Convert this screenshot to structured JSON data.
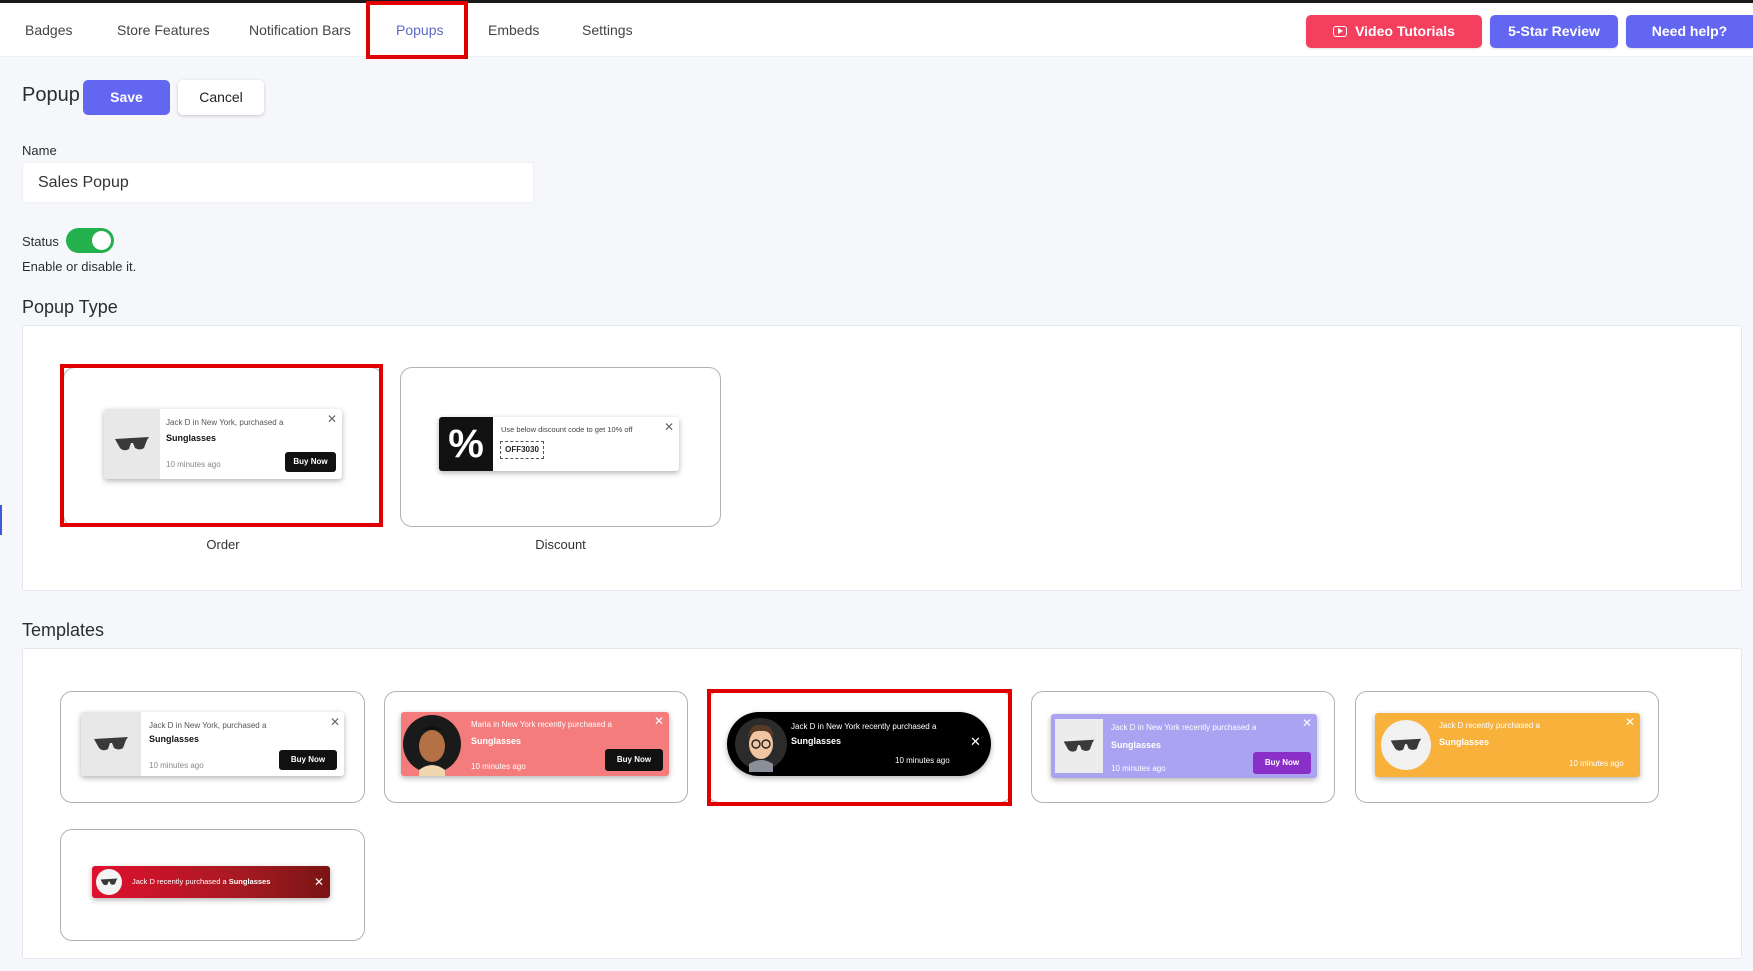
{
  "header": {
    "tabs": [
      {
        "label": "Badges"
      },
      {
        "label": "Store Features"
      },
      {
        "label": "Notification Bars"
      },
      {
        "label": "Popups"
      },
      {
        "label": "Embeds"
      },
      {
        "label": "Settings"
      }
    ],
    "active_tab": "Popups",
    "buttons": {
      "video": "Video Tutorials",
      "review": "5-Star Review",
      "help": "Need help?"
    }
  },
  "page": {
    "title": "Popup",
    "save": "Save",
    "cancel": "Cancel"
  },
  "form": {
    "name_label": "Name",
    "name_value": "Sales Popup",
    "status_label": "Status",
    "status_on": true,
    "status_help": "Enable or disable it."
  },
  "popup_type": {
    "title": "Popup Type",
    "options": [
      {
        "label": "Order",
        "selected": true,
        "preview": {
          "line1": "Jack D in New York, purchased a",
          "product": "Sunglasses",
          "time": "10 minutes ago",
          "cta": "Buy Now",
          "close": "✕"
        }
      },
      {
        "label": "Discount",
        "selected": false,
        "preview": {
          "symbol": "%",
          "line1": "Use below discount code to get 10% off",
          "code": "OFF3030",
          "close": "✕"
        }
      }
    ]
  },
  "templates": {
    "title": "Templates",
    "selected_index": 2,
    "items": [
      {
        "line1": "Jack D in New York, purchased a",
        "product": "Sunglasses",
        "time": "10 minutes ago",
        "cta": "Buy Now",
        "bg": "#ffffff",
        "close": "✕"
      },
      {
        "line1": "Maria in New York recently purchased a",
        "product": "Sunglasses",
        "time": "10 minutes ago",
        "cta": "Buy Now",
        "bg": "#f47c7c",
        "close": "✕"
      },
      {
        "line1": "Jack D in New York recently purchased a",
        "product": "Sunglasses",
        "time": "10 minutes ago",
        "bg": "#000000",
        "close": "✕"
      },
      {
        "line1": "Jack D in New York recently purchased a",
        "product": "Sunglasses",
        "time": "10 minutes ago",
        "cta": "Buy Now",
        "bg": "#a9a3f2",
        "close": "✕"
      },
      {
        "line1": "Jack D recently purchased a",
        "product": "Sunglasses",
        "time": "10 minutes ago",
        "bg": "#f8b13b",
        "close": "✕"
      },
      {
        "text_pre": "Jack D recently purchased a ",
        "product": "Sunglasses",
        "bg": "#c8102e",
        "close": "✕"
      }
    ]
  },
  "colors": {
    "accent": "#6366f1",
    "video_button": "#f43f5e",
    "highlight": "#e00000",
    "toggle_on": "#22b14c"
  }
}
